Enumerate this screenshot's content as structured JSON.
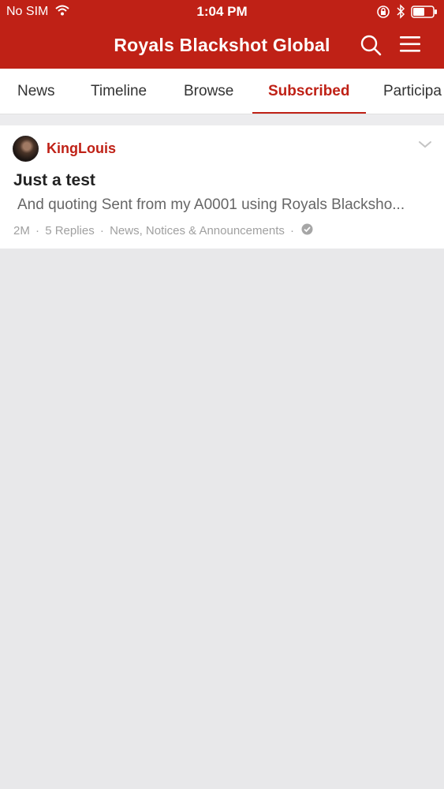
{
  "status_bar": {
    "carrier": "No SIM",
    "time": "1:04 PM",
    "icons": [
      "wifi-icon",
      "rotation-lock-icon",
      "bluetooth-icon",
      "battery-icon"
    ]
  },
  "header": {
    "title": "Royals Blackshot Global",
    "icons": [
      "search-icon",
      "menu-icon"
    ]
  },
  "tabs": [
    {
      "label": "News"
    },
    {
      "label": "Timeline"
    },
    {
      "label": "Browse"
    },
    {
      "label": "Subscribed",
      "active": true
    },
    {
      "label": "Participa"
    }
  ],
  "topics": [
    {
      "author": "KingLouis",
      "title": "Just a test",
      "preview": "And quoting  Sent from my A0001 using Royals Blacksho...",
      "age": "2M",
      "replies": "5 Replies",
      "forum": "News, Notices & Announcements"
    }
  ],
  "colors": {
    "brand": "#bf2116",
    "background": "#e8e8ea"
  }
}
